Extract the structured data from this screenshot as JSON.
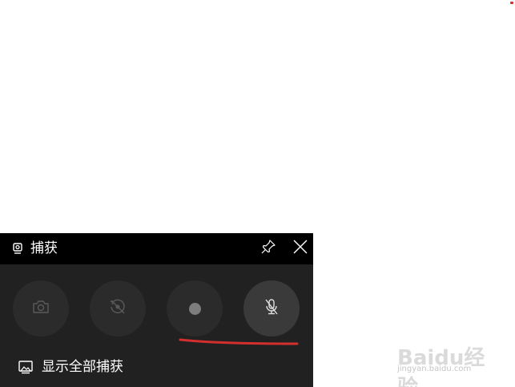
{
  "widget": {
    "title": "捕获",
    "icons": {
      "title": "capture-webcam-icon",
      "pin": "pin-icon",
      "close": "close-icon"
    },
    "buttons": [
      {
        "name": "screenshot-button",
        "icon": "camera-icon",
        "enabled": false
      },
      {
        "name": "record-last-button",
        "icon": "record-last-30s-icon",
        "enabled": false
      },
      {
        "name": "start-recording-button",
        "icon": "record-dot-icon",
        "enabled": true
      },
      {
        "name": "microphone-toggle-button",
        "icon": "microphone-off-icon",
        "enabled": true,
        "state": "muted"
      }
    ],
    "show_all_label": "显示全部捕获",
    "colors": {
      "titlebar_bg": "#000000",
      "panel_bg": "#212121",
      "button_bg": "#2b2b2b",
      "button_active_bg": "#3a3a3a",
      "annotation": "#d32f2f"
    }
  },
  "watermark": {
    "logo_text": "Baidu经验",
    "site": "jingyan.baidu.com"
  }
}
